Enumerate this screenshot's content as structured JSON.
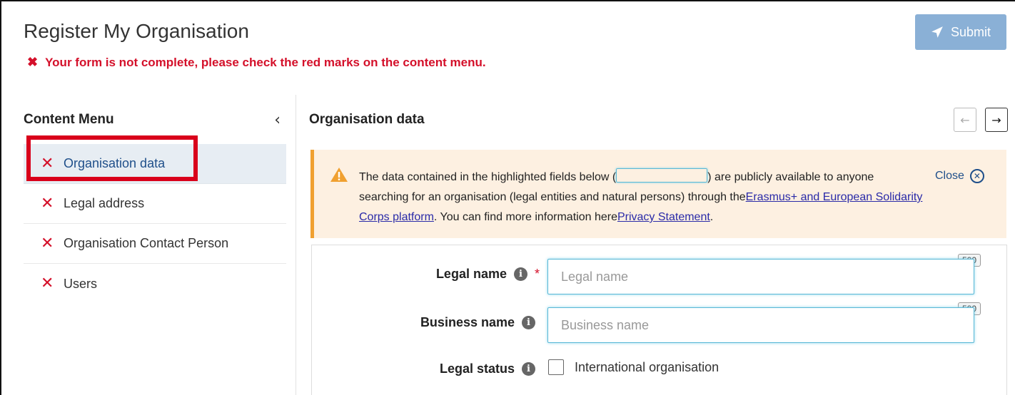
{
  "header": {
    "title": "Register My Organisation",
    "submit_label": "Submit",
    "error_message": "Your form is not complete, please check the red marks on the content menu."
  },
  "sidebar": {
    "title": "Content Menu",
    "items": [
      {
        "label": "Organisation data"
      },
      {
        "label": "Legal address"
      },
      {
        "label": "Organisation Contact Person"
      },
      {
        "label": "Users"
      }
    ]
  },
  "main": {
    "section_title": "Organisation data",
    "notice": {
      "text_before": "The data contained in the highlighted fields below (",
      "text_middle": ") are publicly available to anyone searching for an organisation (legal entities and natural persons) through the",
      "link_platform": "Erasmus+ and European Solidarity Corps platform",
      "text_after": ". You can find more information here",
      "link_privacy": "Privacy Statement",
      "text_end": ".",
      "close_label": "Close"
    },
    "fields": {
      "legal_name": {
        "label": "Legal name",
        "placeholder": "Legal name",
        "max": "500",
        "required": "*"
      },
      "business_name": {
        "label": "Business name",
        "placeholder": "Business name",
        "max": "500"
      },
      "legal_status": {
        "label": "Legal status",
        "option": "International organisation"
      }
    }
  },
  "colors": {
    "error_red": "#d4102a",
    "submit_blue": "#8ab0d6",
    "notice_bg": "#fdf0e1",
    "field_highlight": "#59b8d6"
  }
}
